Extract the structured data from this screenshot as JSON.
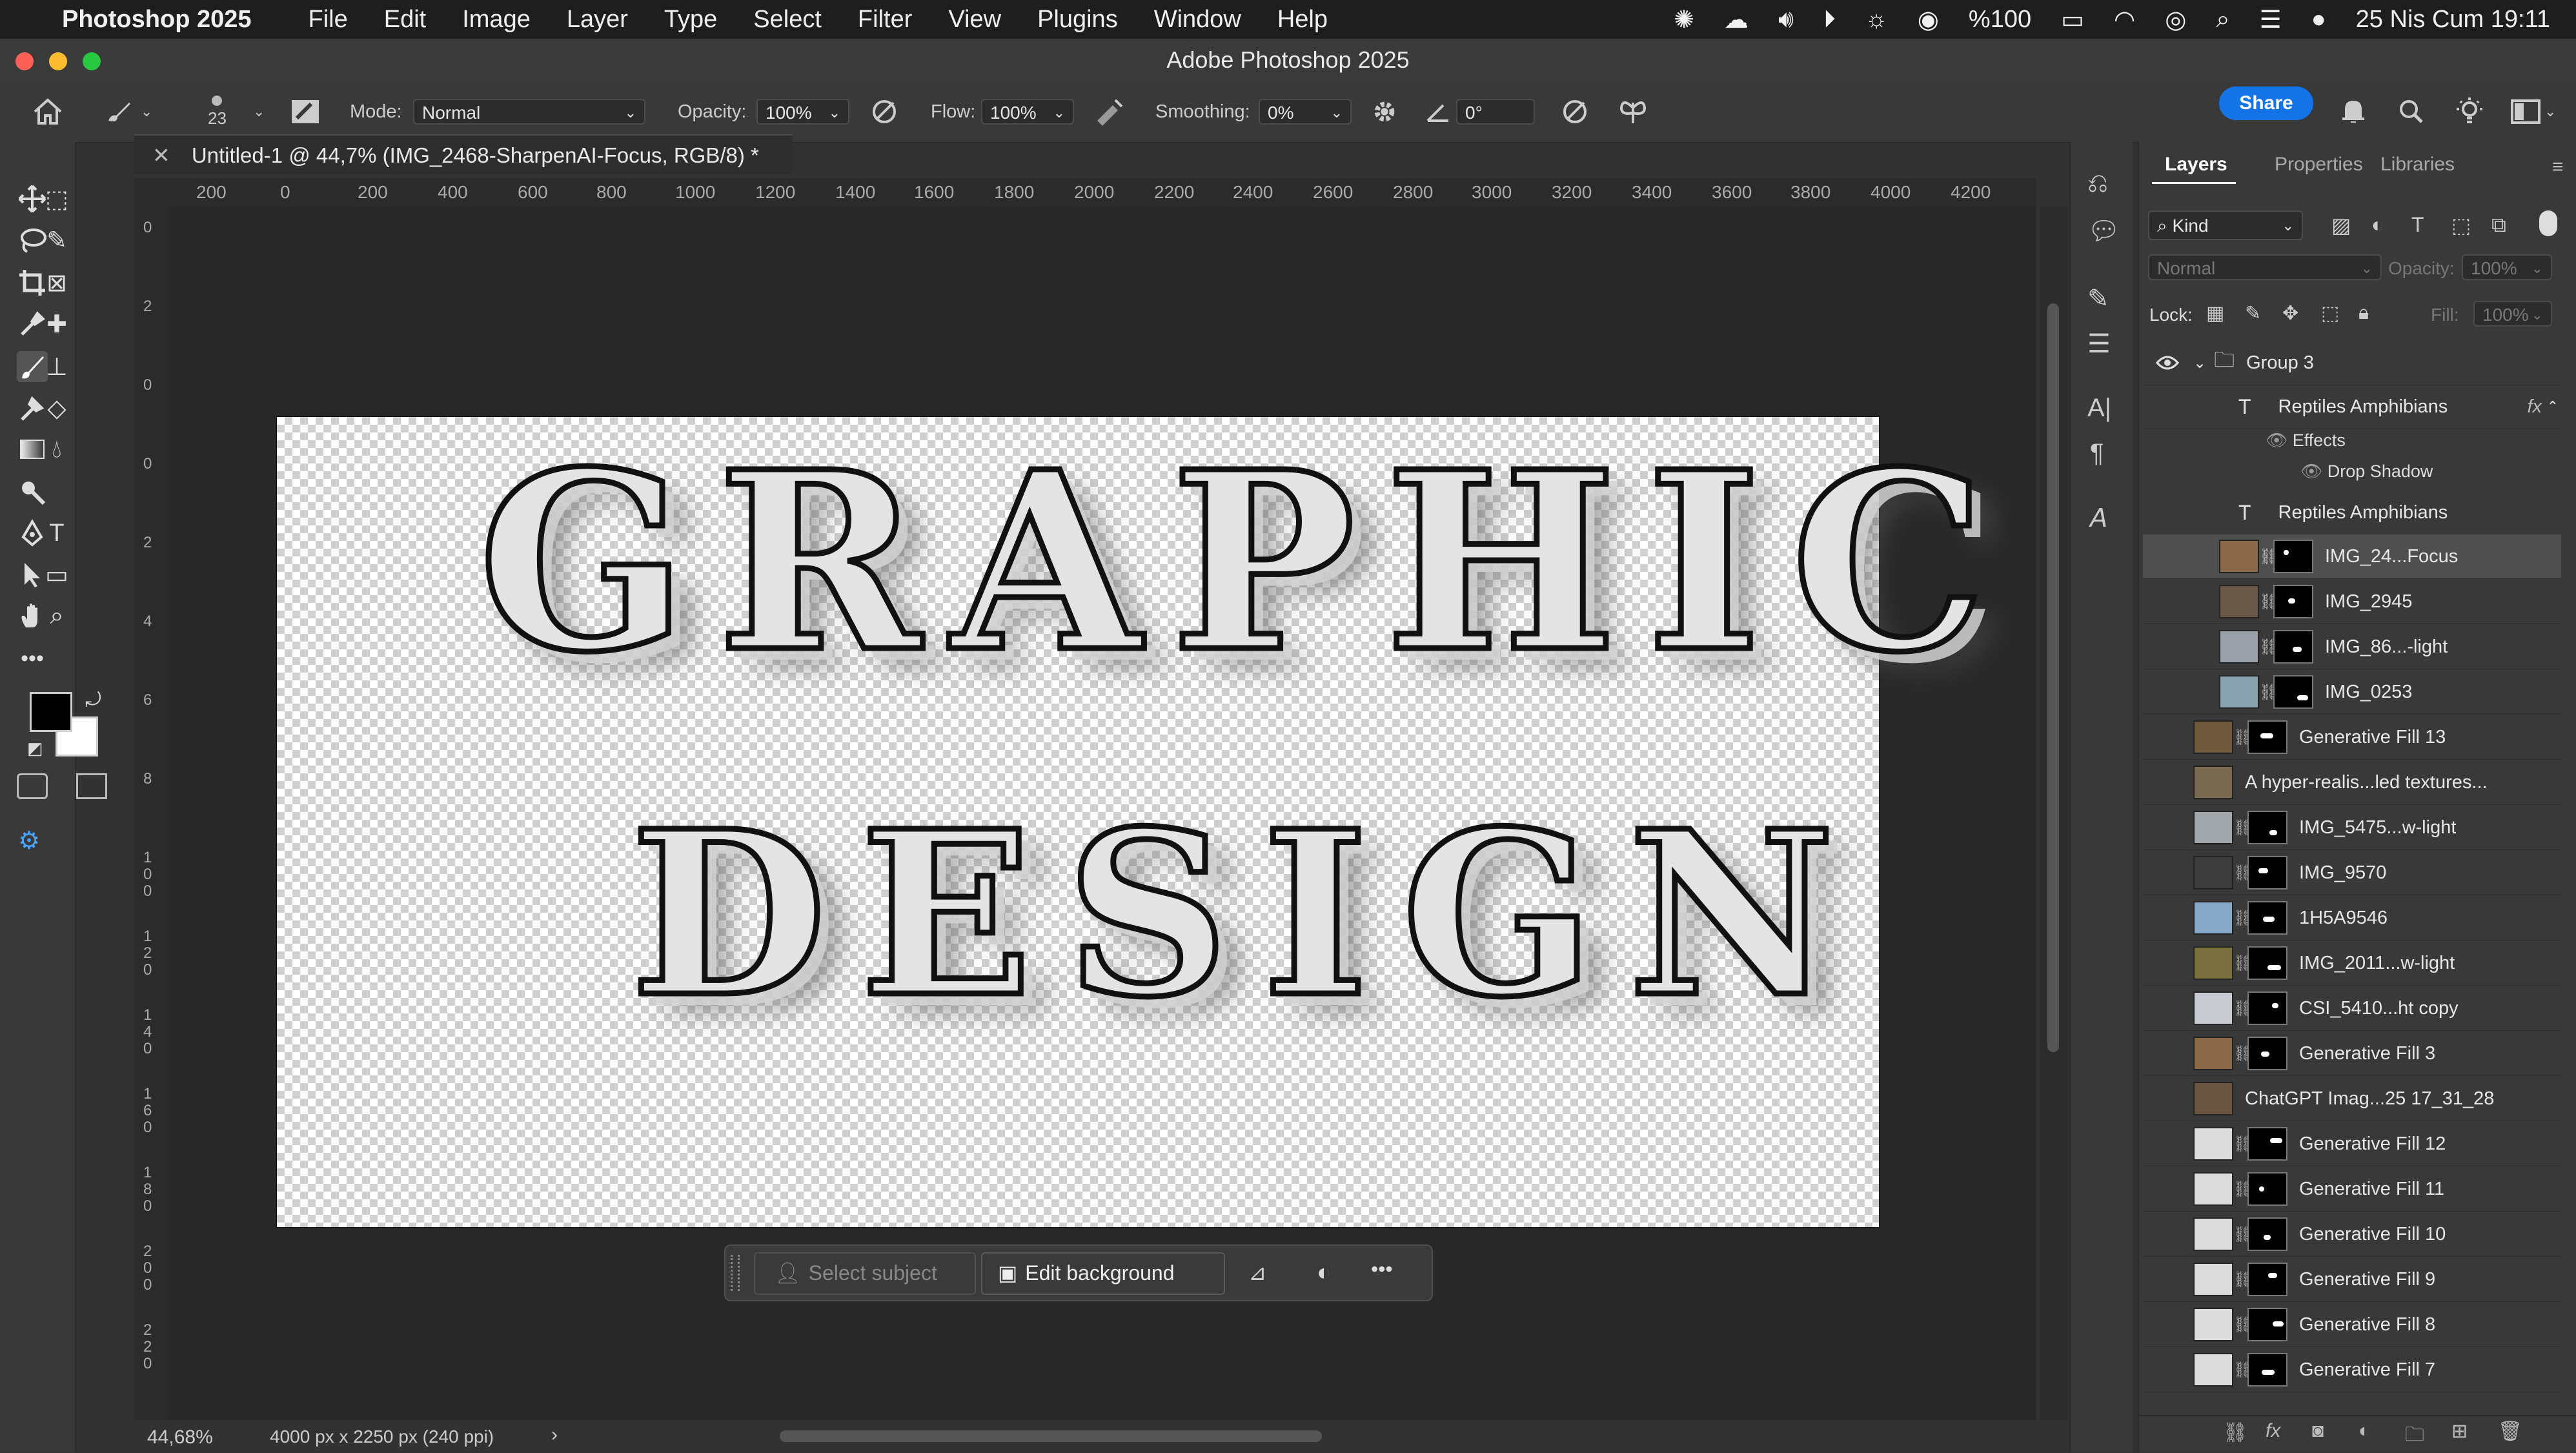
{
  "menubar": {
    "app_name": "Photoshop 2025",
    "menus": [
      "File",
      "Edit",
      "Image",
      "Layer",
      "Type",
      "Select",
      "Filter",
      "View",
      "Plugins",
      "Window",
      "Help"
    ],
    "battery": "%100",
    "datetime": "25 Nis Cum  19:11"
  },
  "window": {
    "title": "Adobe Photoshop 2025"
  },
  "options_bar": {
    "brush_size": "23",
    "mode_label": "Mode:",
    "mode_value": "Normal",
    "opacity_label": "Opacity:",
    "opacity_value": "100%",
    "flow_label": "Flow:",
    "flow_value": "100%",
    "smoothing_label": "Smoothing:",
    "smoothing_value": "0%",
    "angle_value": "0°",
    "share_label": "Share"
  },
  "document": {
    "tab_title": "Untitled-1 @ 44,7% (IMG_2468-SharpenAI-Focus, RGB/8) *",
    "ruler_h": [
      "200",
      "0",
      "200",
      "400",
      "600",
      "800",
      "1000",
      "1200",
      "1400",
      "1600",
      "1800",
      "2000",
      "2200",
      "2400",
      "2600",
      "2800",
      "3000",
      "3200",
      "3400",
      "3600",
      "3800",
      "4000",
      "4200"
    ],
    "ruler_v": [
      "0",
      "2",
      "0",
      "0",
      "2",
      "4",
      "6",
      "8",
      "1 0 0",
      "1 2 0",
      "1 4 0",
      "1 6 0",
      "1 8 0",
      "2 0 0",
      "2 2 0"
    ],
    "canvas_line1": "GRAPHIC",
    "canvas_line2": "DESIGN",
    "zoom": "44,68%",
    "doc_info": "4000 px x 2250 px (240 ppi)"
  },
  "contextual_taskbar": {
    "select_subject": "Select subject",
    "edit_background": "Edit background",
    "more": "•••"
  },
  "colors": {
    "foreground": "#000000",
    "background": "#ffffff",
    "accent": "#1473e6"
  },
  "layers_panel": {
    "tabs": [
      "Layers",
      "Properties",
      "Libraries"
    ],
    "filter_kind": "Kind",
    "blend_mode": "Normal",
    "opacity_label": "Opacity:",
    "opacity_value": "100%",
    "lock_label": "Lock:",
    "fill_label": "Fill:",
    "fill_value": "100%",
    "group": "Group 3",
    "text_layer_1": "Reptiles Amphibians",
    "effects_label": "Effects",
    "drop_shadow_label": "Drop Shadow",
    "text_layer_2": "Reptiles Amphibians",
    "layers": [
      {
        "name": "IMG_24...Focus",
        "indent": true,
        "selected": true
      },
      {
        "name": "IMG_2945",
        "indent": true
      },
      {
        "name": "IMG_86...-light",
        "indent": true
      },
      {
        "name": "IMG_0253",
        "indent": true
      },
      {
        "name": "Generative Fill 13"
      },
      {
        "name": "A hyper-realis...led textures..."
      },
      {
        "name": "IMG_5475...w-light"
      },
      {
        "name": "IMG_9570"
      },
      {
        "name": "1H5A9546"
      },
      {
        "name": "IMG_2011...w-light"
      },
      {
        "name": "CSI_5410...ht copy"
      },
      {
        "name": "Generative Fill 3"
      },
      {
        "name": "ChatGPT Imag...25 17_31_28"
      },
      {
        "name": "Generative Fill 12"
      },
      {
        "name": "Generative Fill 11"
      },
      {
        "name": "Generative Fill 10"
      },
      {
        "name": "Generative Fill 9"
      },
      {
        "name": "Generative Fill 8"
      },
      {
        "name": "Generative Fill 7"
      }
    ]
  }
}
